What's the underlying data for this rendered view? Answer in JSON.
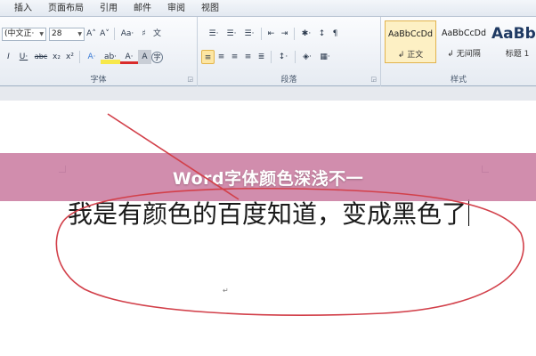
{
  "ribbon": {
    "tabs": [
      "插入",
      "页面布局",
      "引用",
      "邮件",
      "审阅",
      "视图"
    ],
    "font_group": {
      "label": "字体",
      "font_name": "(中文正·",
      "font_size": "28",
      "row1_icons": [
        "A˄",
        "A˅",
        "Aa·",
        "♯",
        "文"
      ],
      "row2_icons": [
        "I",
        "U·",
        "abc",
        "x₂",
        "x²",
        "A·",
        "ab·",
        "A·",
        "A",
        "字"
      ]
    },
    "para_group": {
      "label": "段落",
      "row1_icons": [
        "☰·",
        "☰·",
        "☰·",
        "⇤",
        "⇥",
        "✱·",
        "↕",
        "¶"
      ],
      "row2_icons": [
        "≡",
        "≡",
        "≡",
        "≡",
        "≣",
        "↕·",
        "◈·",
        "▦·"
      ]
    },
    "styles_group": {
      "label": "样式",
      "styles": [
        {
          "preview": "AaBbCcDd",
          "name": "↲ 正文"
        },
        {
          "preview": "AaBbCcDd",
          "name": "↲ 无间隔"
        },
        {
          "preview": "AaBb",
          "name": "标题 1"
        }
      ]
    }
  },
  "document": {
    "text": "我是有颜色的百度知道，变成黑色了",
    "paragraph_mark": "↵"
  },
  "banner": {
    "title": "Word字体颜色深浅不一"
  },
  "colors": {
    "banner": "#c97aa0",
    "annotation": "#d2404a",
    "selected_style": "#fdf0c4"
  }
}
